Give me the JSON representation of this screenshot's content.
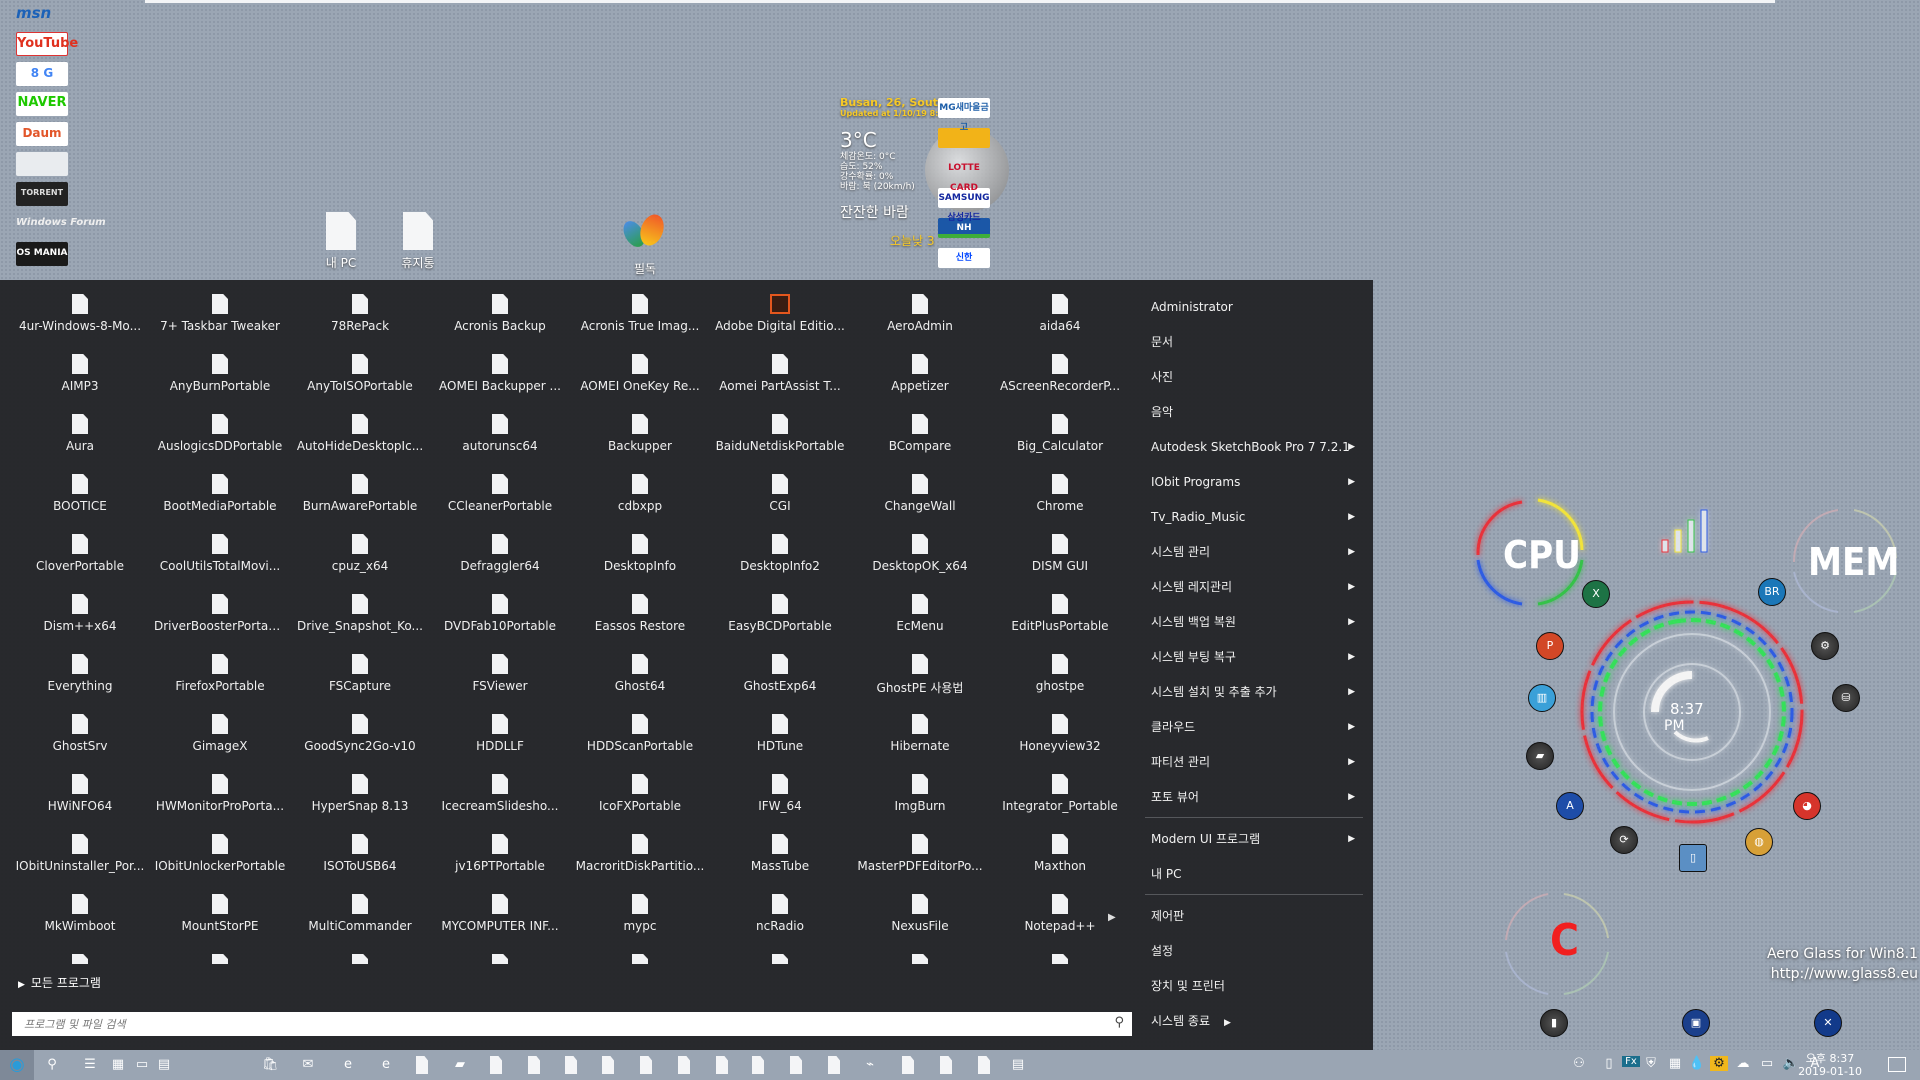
{
  "desktop": {
    "links": [
      "msn",
      "YouTube",
      "8 G",
      "NAVER",
      "Daum",
      "",
      "TORRENT",
      "Windows Forum",
      "OS MANIA"
    ],
    "icons": [
      {
        "label": "내 PC",
        "icon": "document-icon"
      },
      {
        "label": "휴지통",
        "icon": "document-icon"
      },
      {
        "label": "필독",
        "icon": "msn-butterfly-icon"
      }
    ]
  },
  "weather": {
    "location": "Busan, 26, South K",
    "updated": "Updated at 1/10/19 8:00",
    "temperature": "3°C",
    "details": [
      "체감온도: 0°C",
      "습도: 52%",
      "강수확률: 0%",
      "바람: 북 (20km/h)"
    ],
    "condition": "잔잔한 바람",
    "today": "오늘낮 3"
  },
  "banks": [
    "MG새마을금고",
    "",
    "LOTTE CARD",
    "SAMSUNG 삼성카드",
    "NH",
    "신한"
  ],
  "start_menu": {
    "apps": [
      "4ur-Windows-8-Mo...",
      "7+ Taskbar Tweaker",
      "78RePack",
      "Acronis Backup",
      "Acronis True Imag...",
      "Adobe Digital Editio...",
      "AeroAdmin",
      "aida64",
      "AIMP3",
      "AnyBurnPortable",
      "AnyToISOPortable",
      "AOMEI Backupper ...",
      "AOMEI OneKey Re...",
      "Aomei PartAssist T...",
      "Appetizer",
      "AScreenRecorderP...",
      "Aura",
      "AuslogicsDDPortable",
      "AutoHideDesktopIc...",
      "autorunsc64",
      "Backupper",
      "BaiduNetdiskPortable",
      "BCompare",
      "Big_Calculator",
      "BOOTICE",
      "BootMediaPortable",
      "BurnAwarePortable",
      "CCleanerPortable",
      "cdbxpp",
      "CGI",
      "ChangeWall",
      "Chrome",
      "CloverPortable",
      "CoolUtilsTotalMovi...",
      "cpuz_x64",
      "Defraggler64",
      "DesktopInfo",
      "DesktopInfo2",
      "DesktopOK_x64",
      "DISM GUI",
      "Dism++x64",
      "DriverBoosterPortable",
      "Drive_Snapshot_Ko...",
      "DVDFab10Portable",
      "Eassos Restore",
      "EasyBCDPortable",
      "EcMenu",
      "EditPlusPortable",
      "Everything",
      "FirefoxPortable",
      "FSCapture",
      "FSViewer",
      "Ghost64",
      "GhostExp64",
      "GhostPE 사용법",
      "ghostpe",
      "GhostSrv",
      "GimageX",
      "GoodSync2Go-v10",
      "HDDLLF",
      "HDDScanPortable",
      "HDTune",
      "Hibernate",
      "Honeyview32",
      "HWiNFO64",
      "HWMonitorProPorta...",
      "HyperSnap 8.13",
      "IcecreamSlidesho...",
      "IcoFXPortable",
      "IFW_64",
      "ImgBurn",
      "Integrator_Portable",
      "IObitUninstaller_Por...",
      "IObitUnlockerPortable",
      "ISOToUSB64",
      "jv16PTPortable",
      "MacroritDiskPartitio...",
      "MassTube",
      "MasterPDFEditorPo...",
      "Maxthon",
      "MkWimboot",
      "MountStorPE",
      "MultiCommander",
      "MYCOMPUTER INF...",
      "mypc",
      "ncRadio",
      "NexusFile",
      "Notepad++"
    ],
    "all_programs": "모든 프로그램",
    "search_placeholder": "프로그램 및 파일 검색",
    "right_panel": [
      {
        "label": "Administrator",
        "submenu": false
      },
      {
        "label": "문서",
        "submenu": false
      },
      {
        "label": "사진",
        "submenu": false
      },
      {
        "label": "음악",
        "submenu": false
      },
      {
        "label": "Autodesk SketchBook Pro 7 7.2.1",
        "submenu": true
      },
      {
        "label": "IObit Programs",
        "submenu": true
      },
      {
        "label": "Tv_Radio_Music",
        "submenu": true
      },
      {
        "label": "시스템 관리",
        "submenu": true
      },
      {
        "label": "시스템 레지관리",
        "submenu": true
      },
      {
        "label": "시스템 백업 복원",
        "submenu": true
      },
      {
        "label": "시스템 부팅 복구",
        "submenu": true
      },
      {
        "label": "시스템 설치 및 추출 추가",
        "submenu": true
      },
      {
        "label": "클라우드",
        "submenu": true
      },
      {
        "label": "파티션 관리",
        "submenu": true
      },
      {
        "label": "포토 뷰어",
        "submenu": true
      },
      {
        "label": "Modern UI 프로그램",
        "submenu": true
      },
      {
        "label": "내 PC",
        "submenu": false
      },
      {
        "label": "제어판",
        "submenu": false
      },
      {
        "label": "설정",
        "submenu": false
      },
      {
        "label": "장치 및 프린터",
        "submenu": false
      }
    ],
    "shutdown_label": "시스템 종료"
  },
  "gadgets": {
    "cpu_label": "CPU",
    "mem_label": "MEM",
    "drive_label": "C",
    "clock_time": "8:37",
    "clock_ampm": "PM",
    "watermark_line1": "Aero Glass for Win8.1",
    "watermark_line2": "http://www.glass8.eu"
  },
  "taskbar": {
    "pinned_icons": [
      "start-orb-icon",
      "search-icon",
      "task-view-icon",
      "app-icon",
      "window-icon",
      "network-app-icon",
      "store-icon",
      "mail-icon",
      "ie-icon",
      "edge-icon",
      "file-icon",
      "folder-icon",
      "file-icon",
      "file-icon",
      "file-icon",
      "file-icon",
      "file-icon",
      "file-icon",
      "file-icon",
      "file-icon",
      "file-icon",
      "file-icon",
      "monitor-app-icon",
      "file-icon",
      "file-icon",
      "file-icon",
      "window-app-icon"
    ],
    "tray_icons": [
      "people-icon",
      "usb-icon",
      "fx-icon",
      "shield-icon",
      "grid-icon",
      "drop-icon",
      "gear-icon",
      "cloud-icon",
      "network-icon",
      "volume-icon",
      "ime-icon"
    ],
    "ime_label": "A",
    "clock_time": "오후 8:37",
    "clock_date": "2019-01-10"
  }
}
